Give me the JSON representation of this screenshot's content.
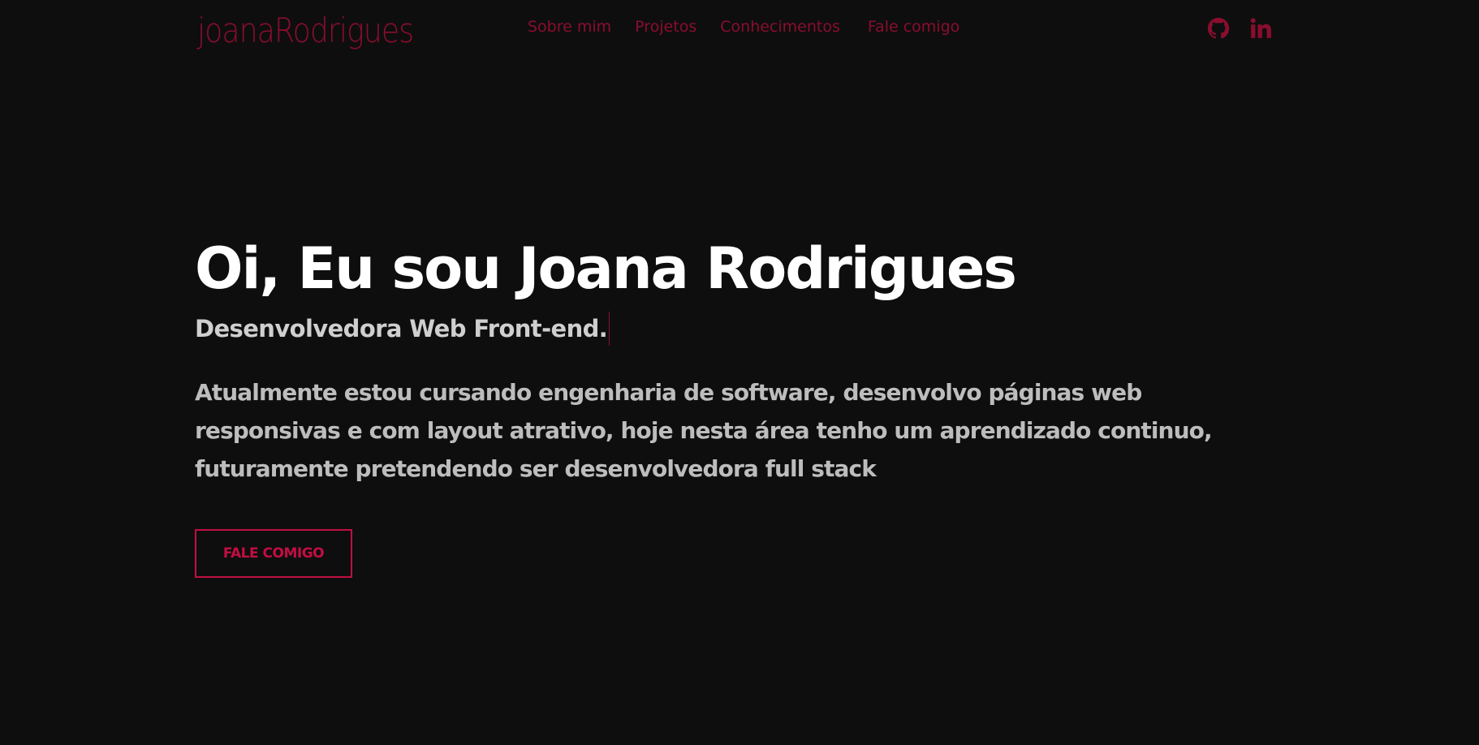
{
  "header": {
    "logo": "joanaRodrigues",
    "nav": [
      {
        "label": "Sobre mim"
      },
      {
        "label": "Projetos"
      },
      {
        "label": "Conhecimentos"
      },
      {
        "label": "Fale comigo"
      }
    ],
    "social": [
      {
        "icon": "github-icon"
      },
      {
        "icon": "linkedin-icon"
      }
    ]
  },
  "hero": {
    "title": "Oi, Eu sou Joana Rodrigues",
    "subtitle": "Desenvolvedora Web Front-end.",
    "description": "Atualmente estou cursando engenharia de software, desenvolvo páginas web responsivas e com layout atrativo, hoje nesta área tenho um aprendizado continuo, futuramente pretendendo ser desenvolvedora full stack",
    "cta_label": "FALE COMIGO"
  },
  "colors": {
    "background": "#0e0e0f",
    "accent": "#8a0d2e",
    "button_accent": "#c20e42",
    "title": "#ffffff",
    "text": "#bdbdbd"
  }
}
